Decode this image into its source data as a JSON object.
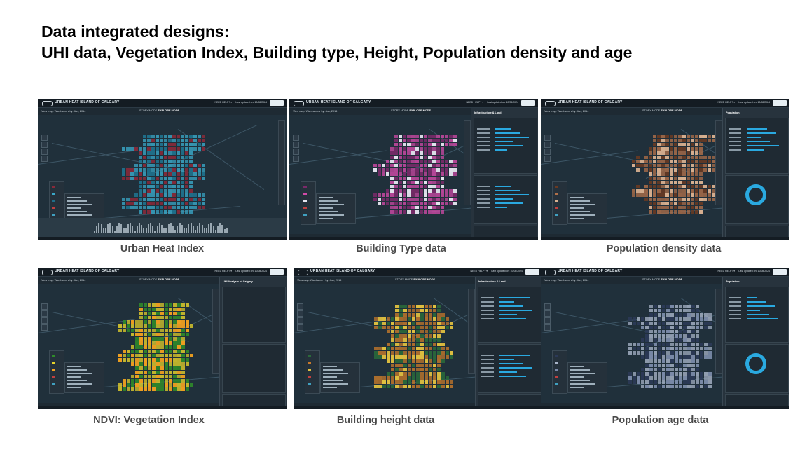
{
  "title": {
    "line1": "Data integrated designs:",
    "line2": "UHI data, Vegetation Index, Building type, Height, Population density and age"
  },
  "app": {
    "title": "URBAN HEAT ISLAND OF CALGARY",
    "need_help": "NEED HELP? ▾",
    "last_updated": "Last updated on: 10/08/2024",
    "view_map": "View map:  Ward-area ▾   by:  Jan, 2014",
    "story_mode": "STORY MODE",
    "explore_mode": "EXPLORE MODE"
  },
  "panels": [
    {
      "caption": "Urban Heat Index",
      "side_title": "",
      "colors": {
        "a": "#3aa8c8",
        "b": "#8a2a3a",
        "c": "#1f6f8a"
      }
    },
    {
      "caption": "Building Type data",
      "side_title": "Infrastructure & Land",
      "colors": {
        "a": "#d14aa8",
        "b": "#7a2a6a",
        "c": "#e6e6f0"
      }
    },
    {
      "caption": "Population density data",
      "side_title": "Population",
      "colors": {
        "a": "#b0704a",
        "b": "#6a3a22",
        "c": "#d8b090"
      }
    },
    {
      "caption": "NDVI: Vegetation Index",
      "side_title": "UHI Analysis of Calgary",
      "colors": {
        "a": "#e6d22a",
        "b": "#2f8a2a",
        "c": "#f0a020"
      }
    },
    {
      "caption": "Building height data",
      "side_title": "Infrastructure & Land",
      "colors": {
        "a": "#c87a2a",
        "b": "#2a6a3a",
        "c": "#e0c040"
      }
    },
    {
      "caption": "Population age data",
      "side_title": "Population",
      "colors": {
        "a": "#a8b4c8",
        "b": "#2c3a58",
        "c": "#7a8aa8"
      }
    }
  ]
}
